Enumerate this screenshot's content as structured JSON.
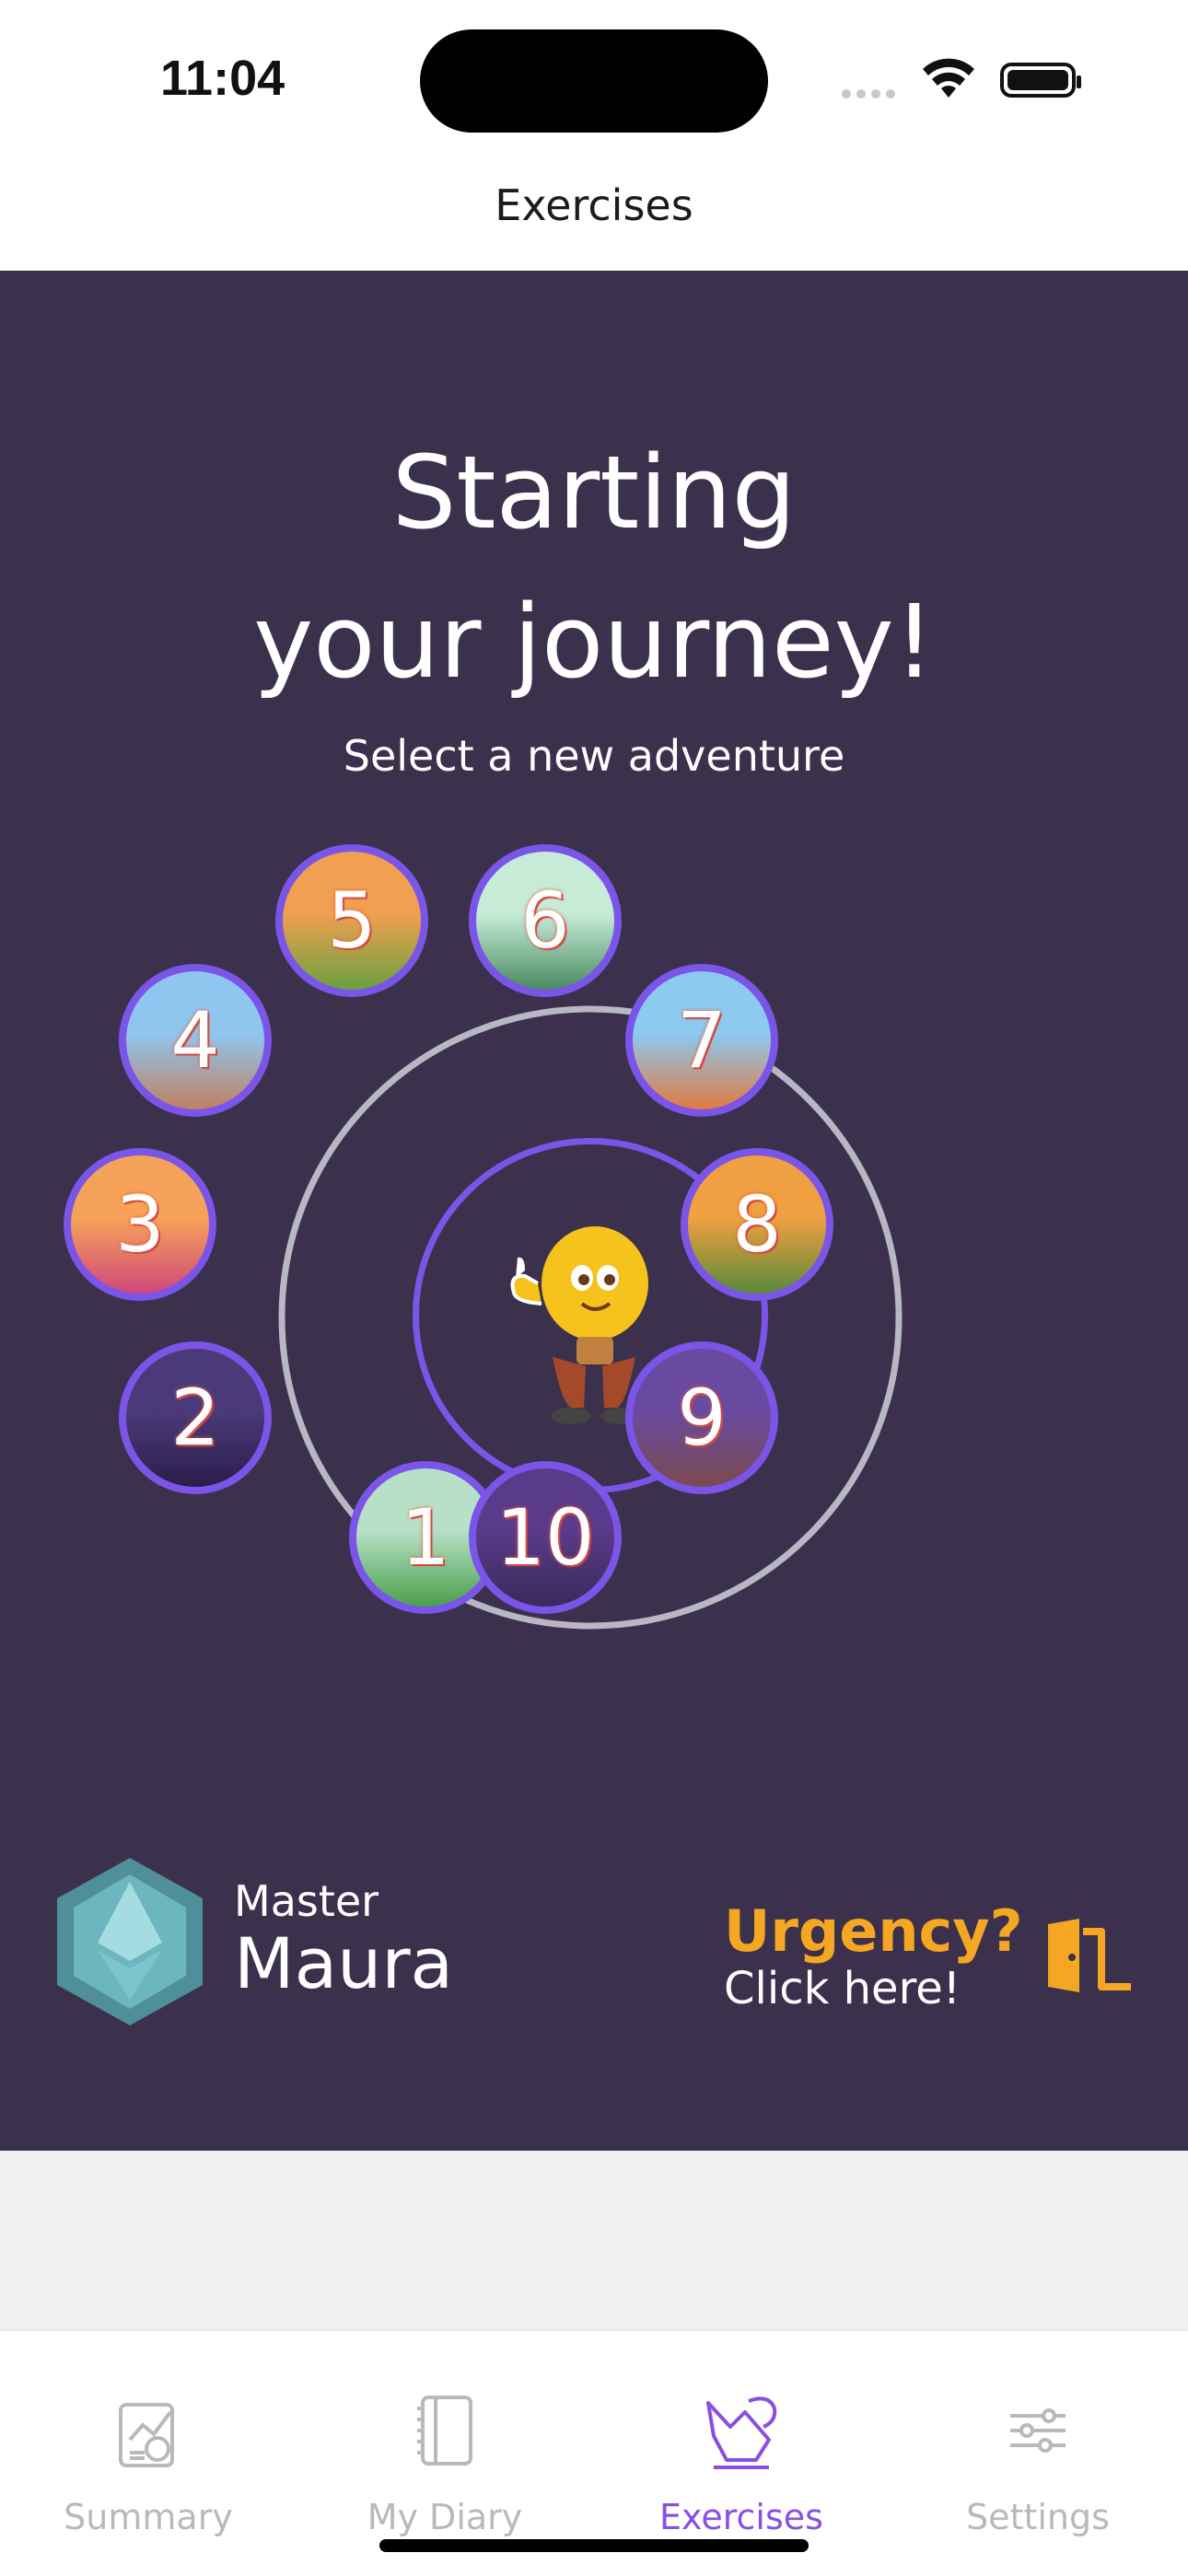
{
  "status_bar": {
    "time": "11:04"
  },
  "nav": {
    "title": "Exercises"
  },
  "hero": {
    "headline_line1": "Starting",
    "headline_line2": "your journey!",
    "subhead": "Select a new adventure"
  },
  "stages": [
    {
      "label": "1",
      "scene": "green-hill",
      "colors": [
        "#b8e0c8",
        "#4aa04a"
      ]
    },
    {
      "label": "2",
      "scene": "night-rock",
      "colors": [
        "#4a3a7a",
        "#2a1e4a"
      ]
    },
    {
      "label": "3",
      "scene": "sunset-palms",
      "colors": [
        "#f6a35a",
        "#d0487a"
      ]
    },
    {
      "label": "4",
      "scene": "blue-sky-rock",
      "colors": [
        "#8fc6f0",
        "#c08060"
      ]
    },
    {
      "label": "5",
      "scene": "orange-hills",
      "colors": [
        "#f0a050",
        "#6aa040"
      ]
    },
    {
      "label": "6",
      "scene": "mint-forest",
      "colors": [
        "#c6ecd8",
        "#4a8a60"
      ]
    },
    {
      "label": "7",
      "scene": "blue-savanna",
      "colors": [
        "#8ccaf0",
        "#e07a40"
      ]
    },
    {
      "label": "8",
      "scene": "orange-mesa",
      "colors": [
        "#f0a040",
        "#5a8a3a"
      ]
    },
    {
      "label": "9",
      "scene": "purple-canyon",
      "colors": [
        "#6a4aa0",
        "#7a4a50"
      ]
    },
    {
      "label": "10",
      "scene": "night-valley",
      "colors": [
        "#5a3a8a",
        "#3a2a5a"
      ]
    }
  ],
  "master": {
    "label": "Master",
    "name": "Maura"
  },
  "urgency": {
    "title": "Urgency?",
    "subtitle": "Click here!"
  },
  "tabs": [
    {
      "label": "Summary",
      "icon": "summary-icon",
      "active": false
    },
    {
      "label": "My Diary",
      "icon": "diary-icon",
      "active": false
    },
    {
      "label": "Exercises",
      "icon": "exercises-icon",
      "active": true
    },
    {
      "label": "Settings",
      "icon": "settings-icon",
      "active": false
    }
  ],
  "colors": {
    "panel_bg": "#3b314c",
    "accent_purple": "#7a55e8",
    "urgency_orange": "#f5a623",
    "tab_active": "#8a4fe0",
    "tab_inactive": "#b9b9b9"
  }
}
